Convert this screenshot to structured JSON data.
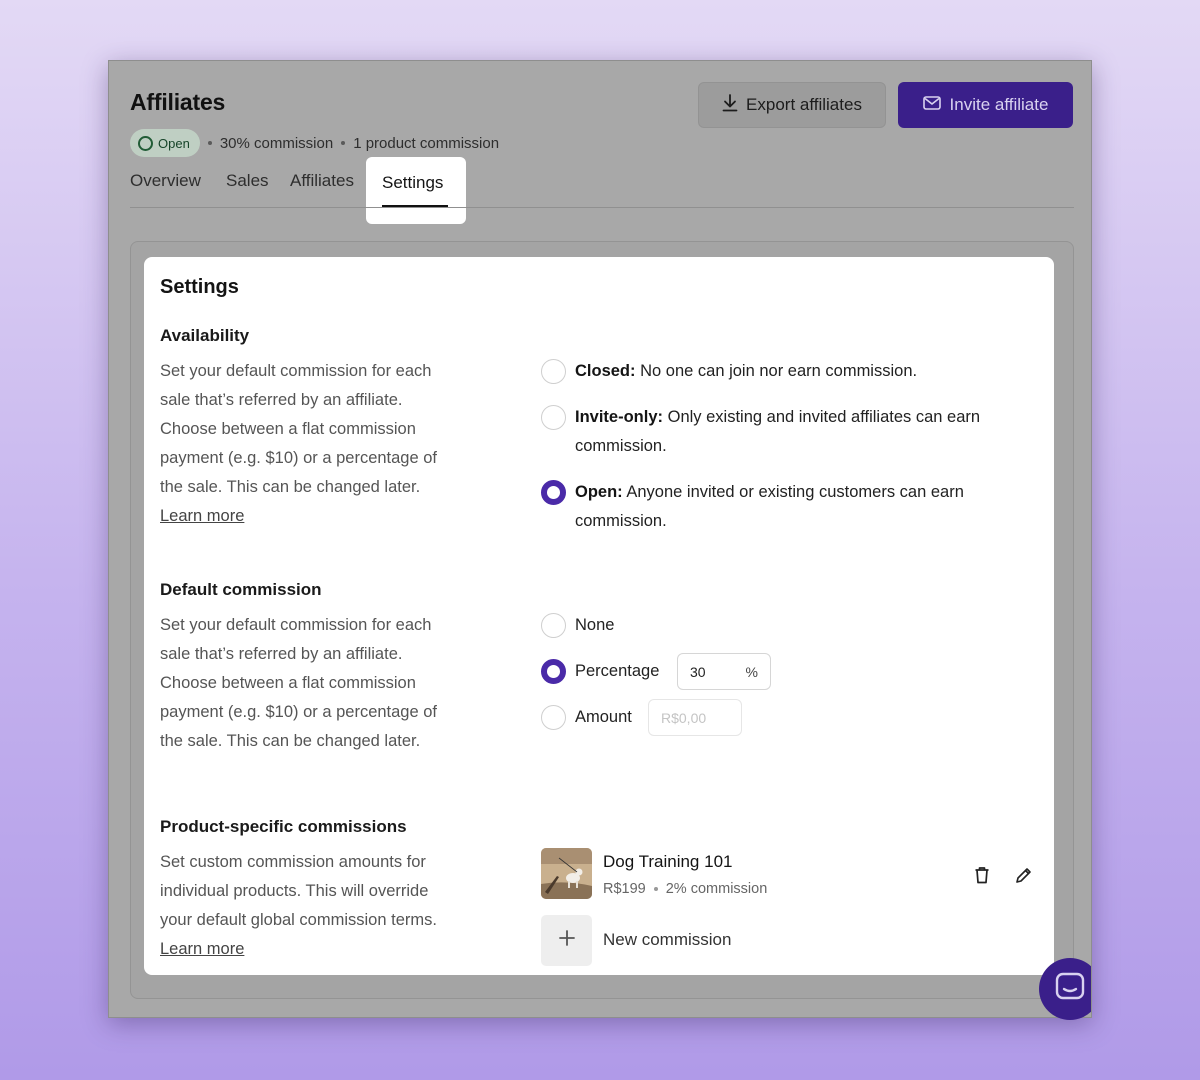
{
  "header": {
    "title": "Affiliates",
    "status_label": "Open",
    "commission_text": "30% commission",
    "product_commission_text": "1 product commission",
    "export_label": "Export affiliates",
    "invite_label": "Invite affiliate"
  },
  "tabs": [
    {
      "label": "Overview",
      "active": false
    },
    {
      "label": "Sales",
      "active": false
    },
    {
      "label": "Affiliates",
      "active": false
    },
    {
      "label": "Settings",
      "active": true
    }
  ],
  "settings": {
    "title": "Settings",
    "availability": {
      "title": "Availability",
      "description": "Set your default commission for each sale that’s referred by an affiliate. Choose between a flat commission payment (e.g. $10) or a percentage of the sale. This can be changed later.",
      "learn_more": "Learn more",
      "options": [
        {
          "label": "Closed:",
          "text": "No one can join nor earn commission.",
          "selected": false
        },
        {
          "label": "Invite-only:",
          "text": "Only existing and invited affiliates can earn commission.",
          "selected": false
        },
        {
          "label": "Open:",
          "text": "Anyone invited or existing customers can earn commission.",
          "selected": true
        }
      ]
    },
    "default_commission": {
      "title": "Default commission",
      "description": "Set your default commission for each sale that’s referred by an affiliate. Choose between a flat commission payment (e.g. $10) or a percentage of the sale. This can be changed later.",
      "options": [
        {
          "label": "None",
          "selected": false
        },
        {
          "label": "Percentage",
          "selected": true
        },
        {
          "label": "Amount",
          "selected": false
        }
      ],
      "percentage_value": "30",
      "percentage_suffix": "%",
      "amount_placeholder": "R$0,00"
    },
    "product_commissions": {
      "title": "Product-specific commissions",
      "description": "Set custom commission amounts for individual products. This will override your default global commission terms.",
      "learn_more": "Learn more",
      "products": [
        {
          "name": "Dog Training 101",
          "price": "R$199",
          "commission": "2% commission"
        }
      ],
      "new_label": "New commission"
    }
  },
  "colors": {
    "accent": "#3a1f8a",
    "radio_selected": "#4a2aa8",
    "status_green": "#215c36"
  },
  "icons": {
    "export": "download-icon",
    "invite": "mail-icon",
    "status": "circle-icon",
    "delete": "trash-icon",
    "edit": "pencil-icon",
    "add": "plus-icon",
    "chat": "chat-icon"
  }
}
